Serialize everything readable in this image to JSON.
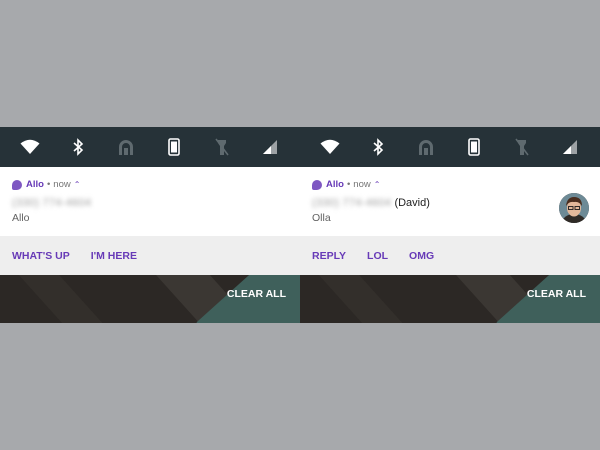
{
  "colors": {
    "background": "#a7a9ac",
    "quick_settings_bar": "#263238",
    "accent": "#673ab7",
    "action_bar": "#eeeeee"
  },
  "quick_settings_icons": [
    "wifi-icon",
    "bluetooth-icon",
    "do-not-disturb-icon",
    "phone-device-icon",
    "flashlight-off-icon",
    "signal-icon"
  ],
  "screens": [
    {
      "notification": {
        "app_name": "Allo",
        "separator": "•",
        "time": "now",
        "expand_glyph": "⌃",
        "sender_phone": "(330) 774-4604",
        "sender_name": "",
        "message": "Allo",
        "has_avatar": false
      },
      "actions": [
        "WHAT'S UP",
        "I'M HERE"
      ],
      "clear_all": "CLEAR ALL"
    },
    {
      "notification": {
        "app_name": "Allo",
        "separator": "•",
        "time": "now",
        "expand_glyph": "⌃",
        "sender_phone": "(330) 774-4604",
        "sender_name": "(David)",
        "message": "Olla",
        "has_avatar": true
      },
      "actions": [
        "REPLY",
        "LOL",
        "OMG"
      ],
      "clear_all": "CLEAR ALL"
    }
  ]
}
